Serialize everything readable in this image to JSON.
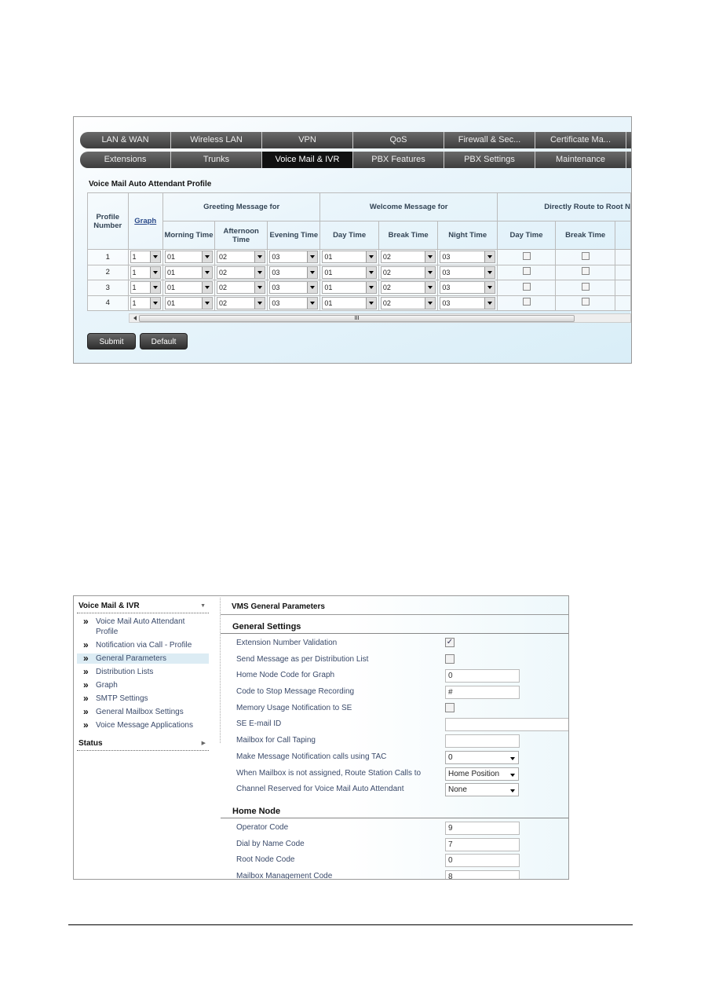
{
  "top_screenshot": {
    "tabs_row1": [
      "LAN & WAN",
      "Wireless LAN",
      "VPN",
      "QoS",
      "Firewall & Sec...",
      "Certificate Ma..."
    ],
    "tabs_row2": [
      "Extensions",
      "Trunks",
      "Voice Mail & IVR",
      "PBX Features",
      "PBX Settings",
      "Maintenance"
    ],
    "active_tab": "Voice Mail & IVR",
    "section_title": "Voice Mail Auto Attendant Profile",
    "headers": {
      "profile_number": "Profile Number",
      "graph": "Graph",
      "greeting": "Greeting Message for",
      "welcome": "Welcome Message for",
      "direct_route": "Directly Route to Root N",
      "sub": [
        "Morning Time",
        "Afternoon Time",
        "Evening Time",
        "Day Time",
        "Break Time",
        "Night Time",
        "Day Time",
        "Break Time"
      ]
    },
    "rows": [
      {
        "num": "1",
        "graph": "1",
        "morning": "01",
        "afternoon": "02",
        "evening": "03",
        "day": "01",
        "break": "02",
        "night": "03"
      },
      {
        "num": "2",
        "graph": "1",
        "morning": "01",
        "afternoon": "02",
        "evening": "03",
        "day": "01",
        "break": "02",
        "night": "03"
      },
      {
        "num": "3",
        "graph": "1",
        "morning": "01",
        "afternoon": "02",
        "evening": "03",
        "day": "01",
        "break": "02",
        "night": "03"
      },
      {
        "num": "4",
        "graph": "1",
        "morning": "01",
        "afternoon": "02",
        "evening": "03",
        "day": "01",
        "break": "02",
        "night": "03"
      }
    ],
    "scroll_grip": "III",
    "submit": "Submit",
    "default": "Default"
  },
  "bottom_screenshot": {
    "sidebar": {
      "group": "Voice Mail & IVR",
      "items": [
        "Voice Mail Auto Attendant Profile",
        "Notification via Call - Profile",
        "General Parameters",
        "Distribution Lists",
        "Graph",
        "SMTP Settings",
        "General Mailbox Settings",
        "Voice Message Applications"
      ],
      "active": "General Parameters",
      "status": "Status"
    },
    "title": "VMS General Parameters",
    "general_settings": {
      "heading": "General Settings",
      "rows": [
        {
          "label": "Extension Number Validation",
          "type": "checkbox",
          "checked": true
        },
        {
          "label": "Send Message as per Distribution List",
          "type": "checkbox",
          "checked": false
        },
        {
          "label": "Home Node Code for Graph",
          "type": "input",
          "value": "0"
        },
        {
          "label": "Code to Stop Message Recording",
          "type": "input",
          "value": "#"
        },
        {
          "label": "Memory Usage Notification to SE",
          "type": "checkbox",
          "checked": false
        },
        {
          "label": "SE E-mail ID",
          "type": "input-wide",
          "value": ""
        },
        {
          "label": "Mailbox for Call Taping",
          "type": "input",
          "value": ""
        },
        {
          "label": "Make Message Notification calls using TAC",
          "type": "select",
          "value": "0"
        },
        {
          "label": "When Mailbox is not assigned, Route Station Calls to",
          "type": "select",
          "value": "Home Position"
        },
        {
          "label": "Channel Reserved for Voice Mail Auto Attendant",
          "type": "select",
          "value": "None"
        }
      ]
    },
    "home_node": {
      "heading": "Home Node",
      "rows": [
        {
          "label": "Operator Code",
          "value": "9"
        },
        {
          "label": "Dial by Name Code",
          "value": "7"
        },
        {
          "label": "Root Node Code",
          "value": "0"
        },
        {
          "label": "Mailbox Management Code",
          "value": "8"
        }
      ]
    }
  }
}
